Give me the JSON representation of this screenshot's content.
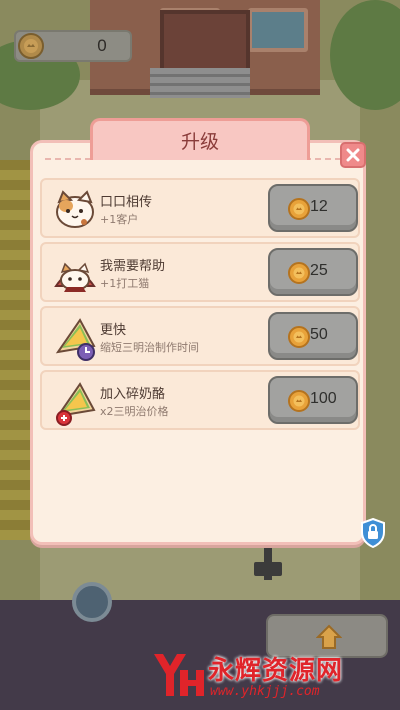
{
  "hud": {
    "coins": "0",
    "coin_icon": "coin-icon"
  },
  "upgrade_panel": {
    "title": "升级",
    "close_icon": "close-icon",
    "items": [
      {
        "name": "口口相传",
        "desc": "+1客户",
        "price": "12",
        "art": "cat-face-icon"
      },
      {
        "name": "我需要帮助",
        "desc": "+1打工猫",
        "price": "25",
        "art": "helper-cat-icon"
      },
      {
        "name": "更快",
        "desc": "缩短三明治制作时间",
        "price": "50",
        "art": "sandwich-clock-icon"
      },
      {
        "name": "加入碎奶酪",
        "desc": "x2三明治价格",
        "price": "100",
        "art": "sandwich-cheese-icon"
      }
    ]
  },
  "misc": {
    "lock_icon": "lock-shield-icon",
    "home_icon": "home-icon"
  },
  "watermark": {
    "title": "永辉资源网",
    "url": "www.yhkjjj.com"
  },
  "colors": {
    "panel_bg": "#fcefe2",
    "panel_border": "#f2bfb8",
    "title_tab": "#f8c7c2",
    "close_red": "#ef8a8a",
    "buy_button_gray": "#a2a2a0",
    "coin_gold": "#e8a23a",
    "watermark_red": "#e0242a"
  }
}
